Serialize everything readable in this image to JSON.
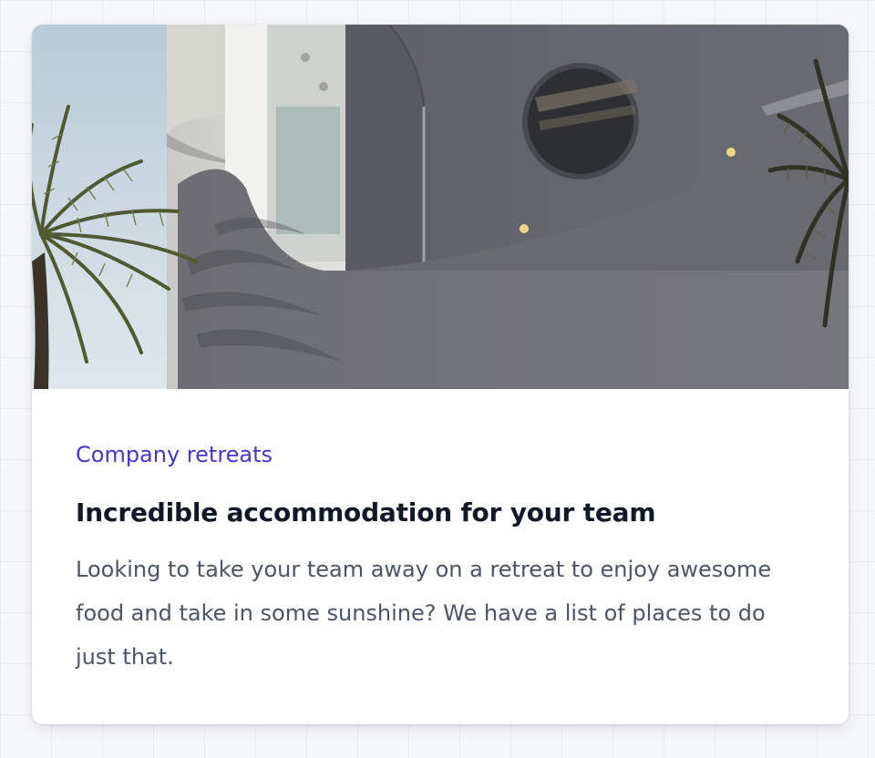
{
  "card": {
    "image": {
      "description": "Concrete building with circular window and palm trees"
    },
    "category": "Company retreats",
    "title": "Incredible accommodation for your team",
    "description": "Looking to take your team away on a retreat to enjoy awesome food and take in some sunshine? We have a list of places to do just that."
  },
  "colors": {
    "category_accent": "#4338ca",
    "title": "#111827",
    "body_text": "#4b5563",
    "card_background": "#ffffff",
    "page_background": "#f5f7fa"
  }
}
